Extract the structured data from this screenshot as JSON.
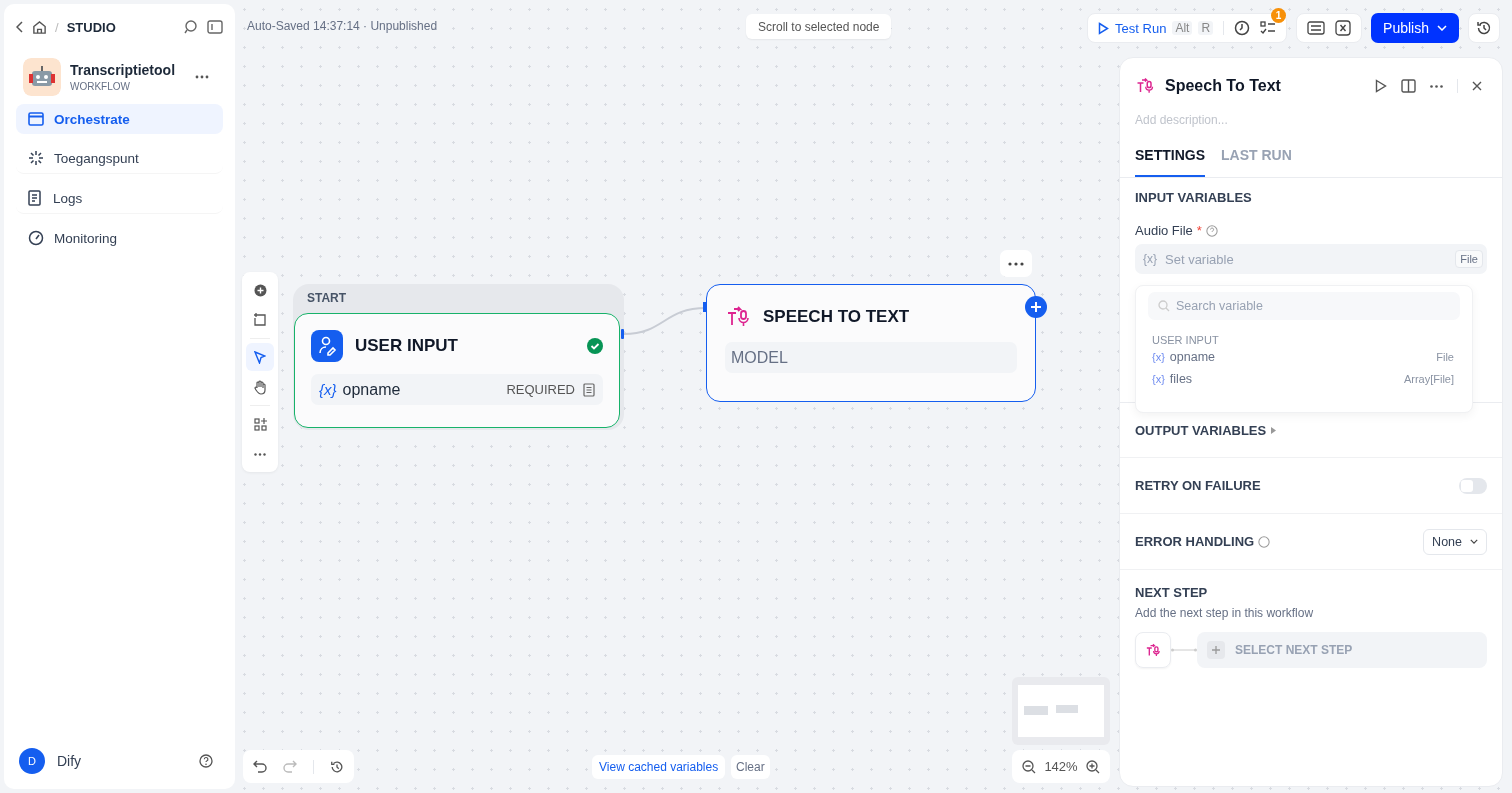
{
  "sidebar": {
    "separator": "/",
    "breadcrumb": "STUDIO",
    "app": {
      "name": "Transcriptietool",
      "type": "WORKFLOW"
    },
    "nav": [
      {
        "kind": "orchestrate",
        "label": "Orchestrate",
        "selected": true
      },
      {
        "kind": "access",
        "label": "Toegangspunt",
        "selected": false
      },
      {
        "kind": "logs",
        "label": "Logs",
        "selected": false
      },
      {
        "kind": "monitoring",
        "label": "Monitoring",
        "selected": false
      }
    ],
    "user": {
      "initial": "D",
      "name": "Dify"
    }
  },
  "canvas": {
    "status": "Auto-Saved 14:37:14 · Unpublished",
    "scroll_hint": "Scroll to selected node",
    "tools": [
      {
        "kind": "add",
        "selected": false
      },
      {
        "kind": "note",
        "selected": false
      },
      {
        "kind": "pointer",
        "selected": true
      },
      {
        "kind": "hand",
        "selected": false
      },
      {
        "kind": "layout",
        "selected": false
      },
      {
        "kind": "more",
        "selected": false
      }
    ],
    "start_node": {
      "tag": "START",
      "title": "USER INPUT",
      "valid": true,
      "variables": [
        {
          "icon": "{x}",
          "name": "opname",
          "badge": "REQUIRED"
        }
      ]
    },
    "stt_node": {
      "title": "SPEECH TO TEXT",
      "field": "MODEL",
      "selected": true
    },
    "cached": "View cached variables",
    "clear": "Clear",
    "zoom": "142%"
  },
  "toolbar": {
    "test_run": "Test Run",
    "keys": [
      "Alt",
      "R"
    ],
    "badge": "1",
    "publish": "Publish"
  },
  "panel": {
    "title": "Speech To Text",
    "description_placeholder": "Add description...",
    "tabs": [
      {
        "label": "SETTINGS",
        "selected": true
      },
      {
        "label": "LAST RUN",
        "selected": false
      }
    ],
    "input_section": "INPUT VARIABLES",
    "audio_label": "Audio File",
    "audio_required": "*",
    "audio_icon": "{x}",
    "audio_placeholder": "Set variable",
    "audio_type": "File",
    "output_section": "OUTPUT VARIABLES",
    "retry": {
      "label": "RETRY ON FAILURE",
      "on": false
    },
    "error": {
      "label": "ERROR HANDLING",
      "value": "None"
    },
    "next": {
      "title": "NEXT STEP",
      "hint": "Add the next step in this workflow",
      "button": "SELECT NEXT STEP"
    },
    "picker": {
      "placeholder": "Search variable",
      "group": "USER INPUT",
      "options": [
        {
          "icon": "{x}",
          "name": "opname",
          "type": "File"
        },
        {
          "icon": "{x}",
          "name": "files",
          "type": "Array[File]"
        }
      ]
    }
  }
}
